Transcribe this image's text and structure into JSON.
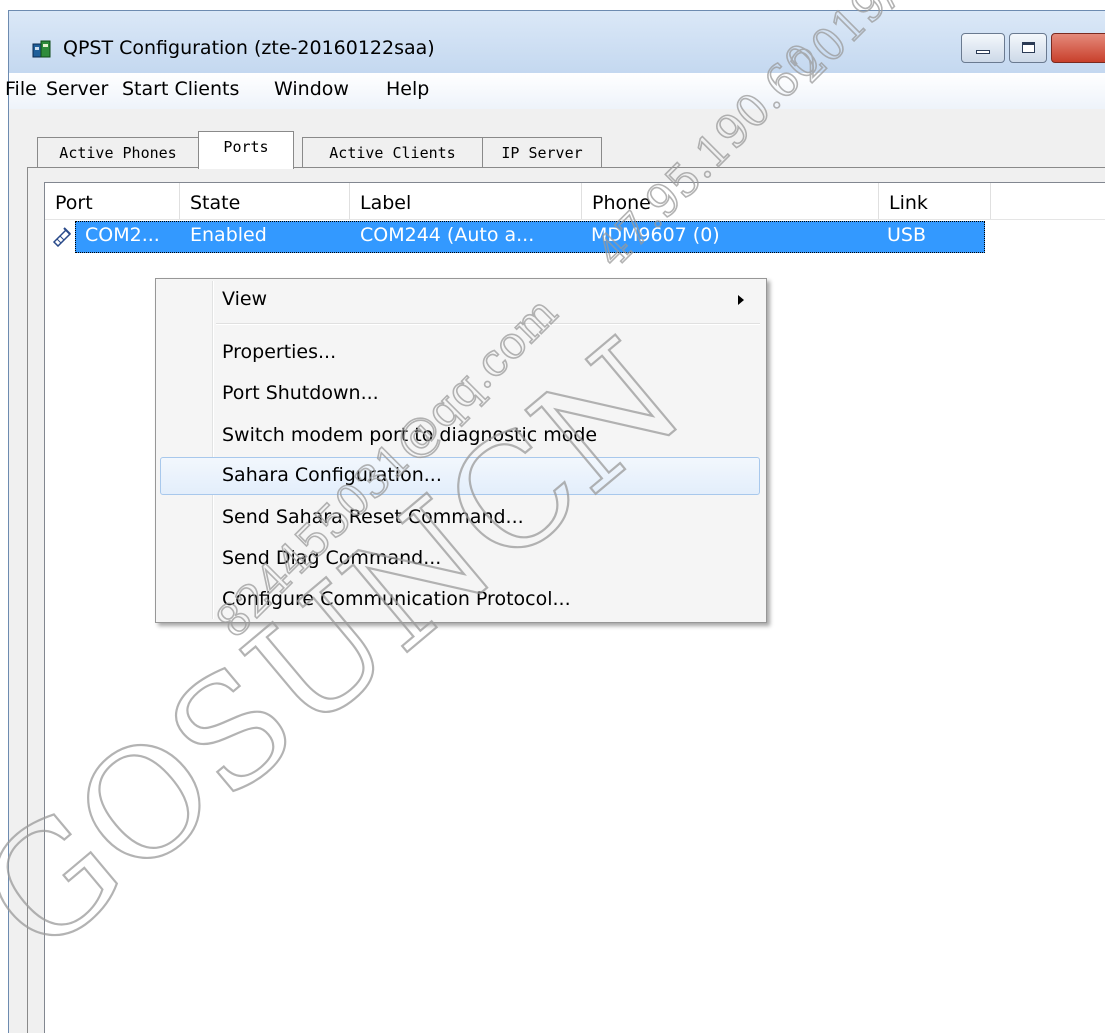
{
  "window": {
    "title": "QPST Configuration (zte-20160122saa)",
    "app_icon": "qpst-phone-icon",
    "accent_color": "#3399ff"
  },
  "menubar": {
    "items": [
      "File",
      "Server",
      "Start Clients",
      "Window",
      "Help"
    ]
  },
  "tabs": {
    "items": [
      "Active Phones",
      "Ports",
      "Active Clients",
      "IP Server"
    ],
    "selected": "Ports"
  },
  "ports_list": {
    "columns": [
      "Port",
      "State",
      "Label",
      "Phone",
      "Link"
    ],
    "rows": [
      {
        "port": "COM2...",
        "state": "Enabled",
        "label": "COM244 (Auto a...",
        "phone": "MDM9607 (0)",
        "link": "USB",
        "icon": "serial-port-icon"
      }
    ]
  },
  "context_menu": {
    "items": [
      "View",
      "Properties...",
      "Port Shutdown...",
      "Switch modem port to diagnostic mode",
      "Sahara Configuration...",
      "Send Sahara Reset Command...",
      "Send Diag Command...",
      "Configure Communication Protocol..."
    ],
    "hovered": "Sahara Configuration..."
  },
  "watermark": {
    "lines": [
      "GOSUNCN",
      "824455031@qq.com",
      "47.95.190.60",
      "2019/"
    ]
  }
}
